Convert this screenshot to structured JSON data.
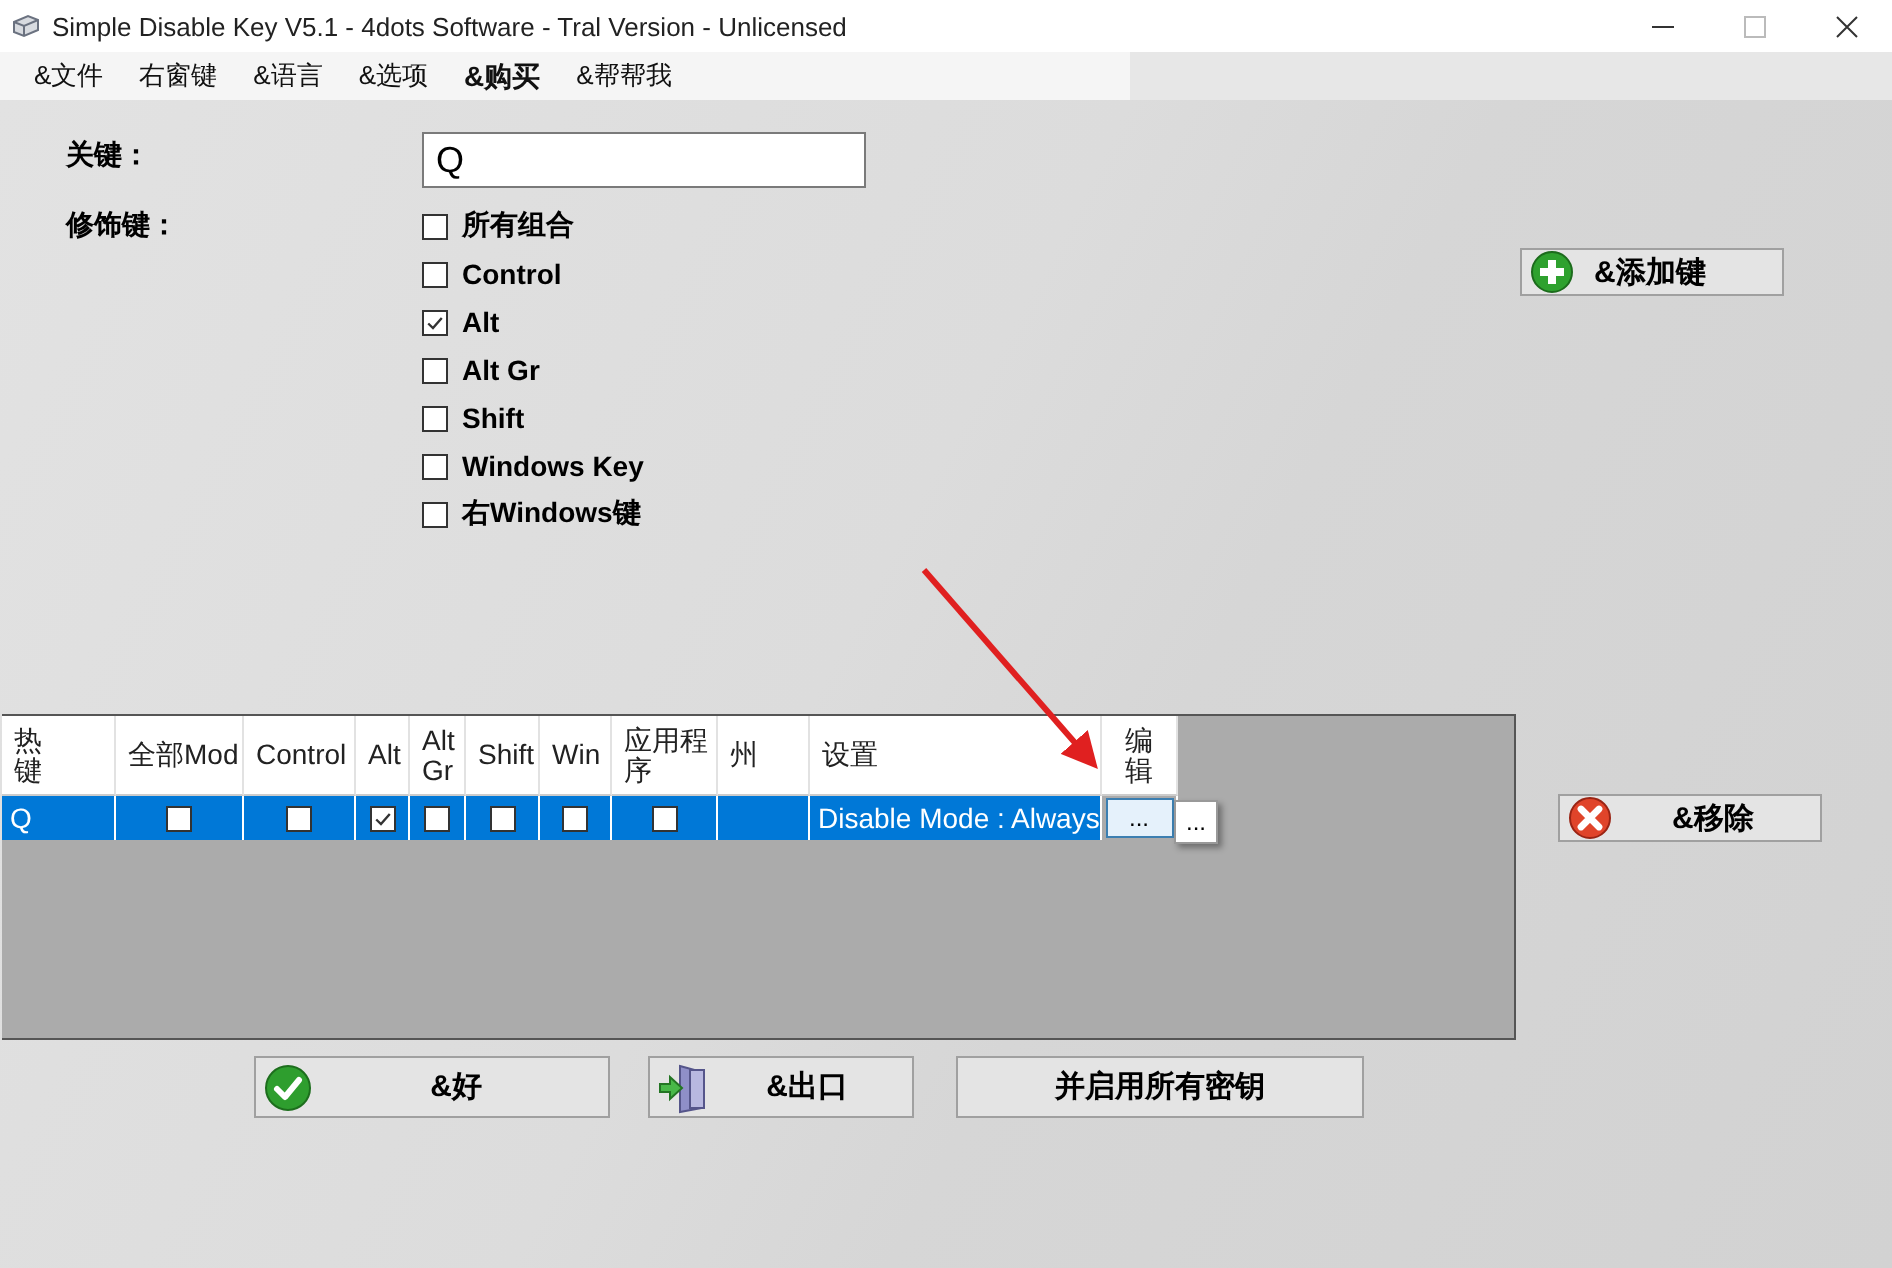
{
  "window": {
    "title": "Simple Disable Key V5.1 - 4dots Software - Tral Version - Unlicensed"
  },
  "menu": [
    {
      "label": "&文件",
      "bold": false
    },
    {
      "label": "右窗键",
      "bold": false
    },
    {
      "label": "&语言",
      "bold": false
    },
    {
      "label": "&选项",
      "bold": false
    },
    {
      "label": "&购买",
      "bold": true
    },
    {
      "label": "&帮帮我",
      "bold": false
    }
  ],
  "form": {
    "key_label": "关键：",
    "key_value": "Q",
    "modifiers_label": "修饰键：",
    "modifiers": [
      {
        "label": "所有组合",
        "checked": false
      },
      {
        "label": "Control",
        "checked": false
      },
      {
        "label": "Alt",
        "checked": true
      },
      {
        "label": "Alt Gr",
        "checked": false
      },
      {
        "label": "Shift",
        "checked": false
      },
      {
        "label": "Windows Key",
        "checked": false
      },
      {
        "label": "右Windows键",
        "checked": false
      }
    ]
  },
  "add_button": "&添加键",
  "table": {
    "columns": [
      {
        "label": "热键",
        "kind": "text"
      },
      {
        "label": "全部Mod",
        "kind": "check"
      },
      {
        "label": "Control",
        "kind": "check"
      },
      {
        "label": "Alt",
        "kind": "check"
      },
      {
        "label": "Alt Gr",
        "kind": "check"
      },
      {
        "label": "Shift",
        "kind": "check"
      },
      {
        "label": "Win",
        "kind": "check"
      },
      {
        "label": "应用程序",
        "kind": "check"
      },
      {
        "label": "州",
        "kind": "text"
      },
      {
        "label": "设置",
        "kind": "text"
      },
      {
        "label": "编辑",
        "kind": "button"
      }
    ],
    "rows": [
      {
        "selected": true,
        "cells": [
          "Q",
          false,
          false,
          true,
          false,
          false,
          false,
          false,
          "",
          "Disable Mode : Always",
          "..."
        ],
        "popup_button": "..."
      }
    ]
  },
  "remove_button": "&移除",
  "buttons": [
    {
      "label": "&好",
      "kind": "ok"
    },
    {
      "label": "&出口",
      "kind": "exit"
    },
    {
      "label": "并启用所有密钥",
      "kind": "plain"
    }
  ]
}
